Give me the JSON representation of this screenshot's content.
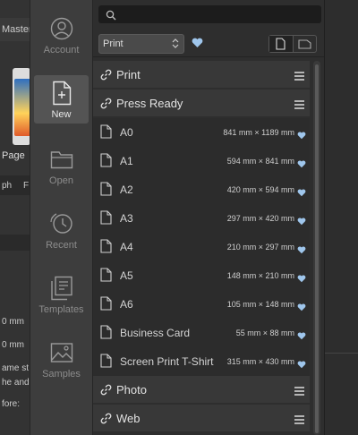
{
  "background_app": {
    "tab_label": "Master",
    "page_label": "Page",
    "fragments": [
      "ph",
      "F",
      "0 mm",
      "0 mm",
      "ame st",
      "he and a",
      "fore:"
    ]
  },
  "sidebar": {
    "items": [
      {
        "label": "Account",
        "icon": "account-icon",
        "active": false
      },
      {
        "label": "New",
        "icon": "new-document-icon",
        "active": true
      },
      {
        "label": "Open",
        "icon": "folder-icon",
        "active": false
      },
      {
        "label": "Recent",
        "icon": "clock-icon",
        "active": false
      },
      {
        "label": "Templates",
        "icon": "templates-icon",
        "active": false
      },
      {
        "label": "Samples",
        "icon": "samples-icon",
        "active": false
      }
    ]
  },
  "search": {
    "placeholder": ""
  },
  "filter": {
    "selected": "Print"
  },
  "colors": {
    "accent": "#9fc6ec",
    "bg": "#2e2e2e",
    "row": "#2c2c2c",
    "category": "#383838"
  },
  "categories": [
    {
      "name": "Print"
    },
    {
      "name": "Press Ready"
    },
    {
      "name": "Photo"
    },
    {
      "name": "Web"
    }
  ],
  "presets": [
    {
      "name": "A0",
      "size": "841 mm × 1189 mm"
    },
    {
      "name": "A1",
      "size": "594 mm × 841 mm"
    },
    {
      "name": "A2",
      "size": "420 mm × 594 mm"
    },
    {
      "name": "A3",
      "size": "297 mm × 420 mm"
    },
    {
      "name": "A4",
      "size": "210 mm × 297 mm"
    },
    {
      "name": "A5",
      "size": "148 mm × 210 mm"
    },
    {
      "name": "A6",
      "size": "105 mm × 148 mm"
    },
    {
      "name": "Business Card",
      "size": "55 mm × 88 mm"
    },
    {
      "name": "Screen Print T-Shirt",
      "size": "315 mm × 430 mm"
    }
  ]
}
